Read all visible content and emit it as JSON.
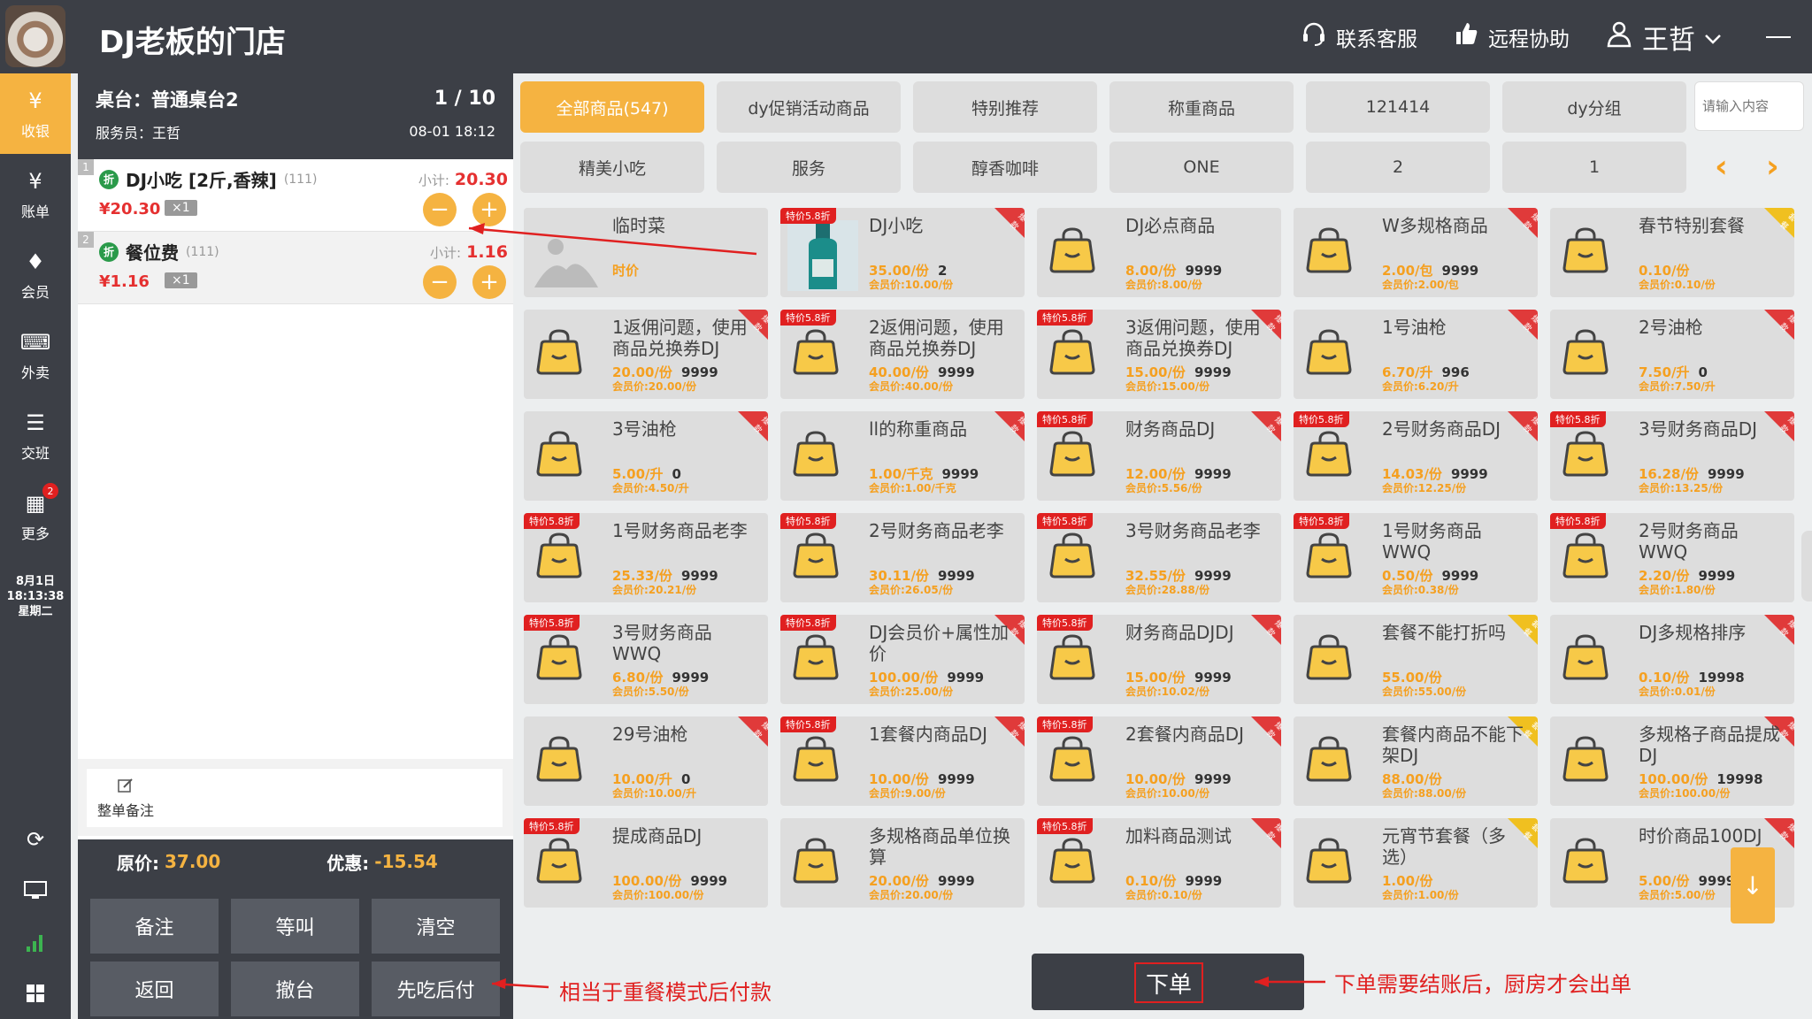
{
  "header": {
    "shop_name": "DJ老板的门店",
    "service_label": "联系客服",
    "remote_label": "远程协助",
    "user_name": "王哲"
  },
  "nav": {
    "items": [
      {
        "label": "收银",
        "icon": "register-icon",
        "glyph": "¥"
      },
      {
        "label": "账单",
        "icon": "bill-icon",
        "glyph": "¥"
      },
      {
        "label": "会员",
        "icon": "member-icon",
        "glyph": "♦"
      },
      {
        "label": "外卖",
        "icon": "takeout-icon",
        "glyph": "⌨"
      },
      {
        "label": "交班",
        "icon": "shift-icon",
        "glyph": "☰"
      },
      {
        "label": "更多",
        "icon": "more-icon",
        "glyph": "▦",
        "badge": "2"
      }
    ],
    "date": "8月1日",
    "time": "18:13:38",
    "weekday": "星期二"
  },
  "order": {
    "desk": "桌台：普通桌台2",
    "waiter": "服务员：王哲",
    "page": "1 / 10",
    "datetime": "08-01 18:12",
    "subtotal_label": "小计:",
    "lines": [
      {
        "no": "1",
        "disc": "折",
        "name": "DJ小吃 [2斤,香辣]",
        "code": "(111)",
        "subtotal": "20.30",
        "price": "¥20.30",
        "qty": "×1"
      },
      {
        "no": "2",
        "disc": "折",
        "name": "餐位费",
        "code": "(111)",
        "subtotal": "1.16",
        "price": "¥1.16",
        "qty": "×1"
      }
    ],
    "remark_label": "整单备注",
    "orig_label": "原价:",
    "orig_value": "37.00",
    "discount_label": "优惠:",
    "discount_value": "-15.54",
    "buttons": {
      "note": "备注",
      "call": "等叫",
      "clear": "清空",
      "back": "返回",
      "cancel": "撤台",
      "eat_first": "先吃后付"
    }
  },
  "categories": {
    "row1": [
      "全部商品(547)",
      "dy促销活动商品",
      "特别推荐",
      "称重商品",
      "121414",
      "dy分组"
    ],
    "row2": [
      "精美小吃",
      "服务",
      "醇香咖啡",
      "ONE",
      "2",
      "1"
    ],
    "search_placeholder": "请输入内容"
  },
  "colors": {
    "accent": "#f5b341",
    "dark": "#3c3f46",
    "red": "#e02020"
  },
  "products": [
    {
      "name": "临时菜",
      "price": "时价",
      "stock": "",
      "member": "",
      "tag": "",
      "corner": "",
      "img": "placeholder"
    },
    {
      "name": "DJ小吃",
      "price": "35.00/份",
      "stock": "2",
      "member": "会员价:10.00/份",
      "tag": "特价5.8折",
      "corner": "red",
      "img": "bottle"
    },
    {
      "name": "DJ必点商品",
      "price": "8.00/份",
      "stock": "9999",
      "member": "会员价:8.00/份",
      "tag": "",
      "corner": "",
      "img": "bag"
    },
    {
      "name": "W多规格商品",
      "price": "2.00/包",
      "stock": "9999",
      "member": "会员价:2.00/包",
      "tag": "",
      "corner": "red",
      "img": "bag"
    },
    {
      "name": "春节特别套餐",
      "price": "0.10/份",
      "stock": "",
      "member": "会员价:0.10/份",
      "tag": "",
      "corner": "yellow",
      "img": "bag"
    },
    {
      "name": "1返佣问题，使用商品兑换券DJ",
      "price": "20.00/份",
      "stock": "9999",
      "member": "会员价:20.00/份",
      "tag": "",
      "corner": "red",
      "img": "bag"
    },
    {
      "name": "2返佣问题，使用商品兑换券DJ",
      "price": "40.00/份",
      "stock": "9999",
      "member": "会员价:40.00/份",
      "tag": "特价5.8折",
      "corner": "",
      "img": "bag"
    },
    {
      "name": "3返佣问题，使用商品兑换券DJ",
      "price": "15.00/份",
      "stock": "9999",
      "member": "会员价:15.00/份",
      "tag": "特价5.8折",
      "corner": "red",
      "img": "bag"
    },
    {
      "name": "1号油枪",
      "price": "6.70/升",
      "stock": "996",
      "member": "会员价:6.20/升",
      "tag": "",
      "corner": "red",
      "img": "bag"
    },
    {
      "name": "2号油枪",
      "price": "7.50/升",
      "stock": "0",
      "member": "会员价:7.50/升",
      "tag": "",
      "corner": "red",
      "img": "bag"
    },
    {
      "name": "3号油枪",
      "price": "5.00/升",
      "stock": "0",
      "member": "会员价:4.50/升",
      "tag": "",
      "corner": "red",
      "img": "bag"
    },
    {
      "name": "ll的称重商品",
      "price": "1.00/千克",
      "stock": "9999",
      "member": "会员价:1.00/千克",
      "tag": "",
      "corner": "red",
      "img": "bag"
    },
    {
      "name": "财务商品DJ",
      "price": "12.00/份",
      "stock": "9999",
      "member": "会员价:5.56/份",
      "tag": "特价5.8折",
      "corner": "red",
      "img": "bag"
    },
    {
      "name": "2号财务商品DJ",
      "price": "14.03/份",
      "stock": "9999",
      "member": "会员价:12.25/份",
      "tag": "特价5.8折",
      "corner": "red",
      "img": "bag"
    },
    {
      "name": "3号财务商品DJ",
      "price": "16.28/份",
      "stock": "9999",
      "member": "会员价:13.25/份",
      "tag": "特价5.8折",
      "corner": "red",
      "img": "bag"
    },
    {
      "name": "1号财务商品老李",
      "price": "25.33/份",
      "stock": "9999",
      "member": "会员价:20.21/份",
      "tag": "特价5.8折",
      "corner": "",
      "img": "bag"
    },
    {
      "name": "2号财务商品老李",
      "price": "30.11/份",
      "stock": "9999",
      "member": "会员价:26.05/份",
      "tag": "特价5.8折",
      "corner": "",
      "img": "bag"
    },
    {
      "name": "3号财务商品老李",
      "price": "32.55/份",
      "stock": "9999",
      "member": "会员价:28.88/份",
      "tag": "特价5.8折",
      "corner": "",
      "img": "bag"
    },
    {
      "name": "1号财务商品WWQ",
      "price": "0.50/份",
      "stock": "9999",
      "member": "会员价:0.38/份",
      "tag": "特价5.8折",
      "corner": "",
      "img": "bag"
    },
    {
      "name": "2号财务商品WWQ",
      "price": "2.20/份",
      "stock": "9999",
      "member": "会员价:1.80/份",
      "tag": "特价5.8折",
      "corner": "",
      "img": "bag"
    },
    {
      "name": "3号财务商品WWQ",
      "price": "6.80/份",
      "stock": "9999",
      "member": "会员价:5.50/份",
      "tag": "特价5.8折",
      "corner": "",
      "img": "bag"
    },
    {
      "name": "DJ会员价+属性加价",
      "price": "100.00/份",
      "stock": "9999",
      "member": "会员价:25.00/份",
      "tag": "特价5.8折",
      "corner": "red",
      "img": "bag"
    },
    {
      "name": "财务商品DJDJ",
      "price": "15.00/份",
      "stock": "9999",
      "member": "会员价:10.02/份",
      "tag": "特价5.8折",
      "corner": "red",
      "img": "bag"
    },
    {
      "name": "套餐不能打折吗",
      "price": "55.00/份",
      "stock": "",
      "member": "会员价:55.00/份",
      "tag": "",
      "corner": "yellow",
      "img": "bag"
    },
    {
      "name": "DJ多规格排序",
      "price": "0.10/份",
      "stock": "19998",
      "member": "会员价:0.01/份",
      "tag": "",
      "corner": "red",
      "img": "bag"
    },
    {
      "name": "29号油枪",
      "price": "10.00/升",
      "stock": "0",
      "member": "会员价:10.00/升",
      "tag": "",
      "corner": "red",
      "img": "bag"
    },
    {
      "name": "1套餐内商品DJ",
      "price": "10.00/份",
      "stock": "9999",
      "member": "会员价:9.00/份",
      "tag": "特价5.8折",
      "corner": "red",
      "img": "bag"
    },
    {
      "name": "2套餐内商品DJ",
      "price": "10.00/份",
      "stock": "9999",
      "member": "会员价:10.00/份",
      "tag": "特价5.8折",
      "corner": "red",
      "img": "bag"
    },
    {
      "name": "套餐内商品不能下架DJ",
      "price": "88.00/份",
      "stock": "",
      "member": "会员价:88.00/份",
      "tag": "",
      "corner": "yellow",
      "img": "bag"
    },
    {
      "name": "多规格子商品提成DJ",
      "price": "100.00/份",
      "stock": "19998",
      "member": "会员价:100.00/份",
      "tag": "",
      "corner": "red",
      "img": "bag"
    },
    {
      "name": "提成商品DJ",
      "price": "100.00/份",
      "stock": "9999",
      "member": "会员价:100.00/份",
      "tag": "特价5.8折",
      "corner": "",
      "img": "bag"
    },
    {
      "name": "多规格商品单位换算",
      "price": "20.00/份",
      "stock": "9999",
      "member": "会员价:20.00/份",
      "tag": "",
      "corner": "",
      "img": "bag"
    },
    {
      "name": "加料商品测试",
      "price": "0.10/份",
      "stock": "9999",
      "member": "会员价:0.10/份",
      "tag": "特价5.8折",
      "corner": "red",
      "img": "bag"
    },
    {
      "name": "元宵节套餐（多选）",
      "price": "1.00/份",
      "stock": "",
      "member": "会员价:1.00/份",
      "tag": "",
      "corner": "yellow",
      "img": "bag"
    },
    {
      "name": "时价商品100DJ",
      "price": "5.00/份",
      "stock": "9999",
      "member": "会员价:5.00/份",
      "tag": "",
      "corner": "red",
      "img": "bag"
    }
  ],
  "corner_text": {
    "red": "爆款",
    "yellow": "套餐"
  },
  "bottom": {
    "order_label": "下单",
    "annotation_left": "相当于重餐模式后付款",
    "annotation_right": "下单需要结账后，厨房才会出单"
  }
}
